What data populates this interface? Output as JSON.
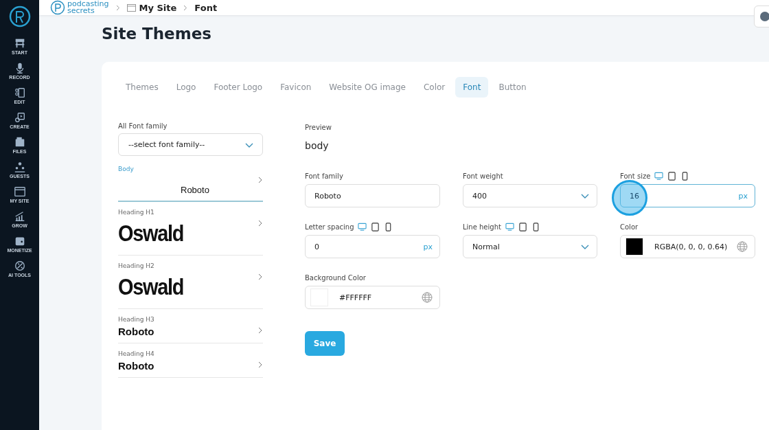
{
  "sidebar": {
    "items": [
      {
        "label": "START"
      },
      {
        "label": "RECORD"
      },
      {
        "label": "EDIT"
      },
      {
        "label": "CREATE"
      },
      {
        "label": "FILES"
      },
      {
        "label": "GUESTS"
      },
      {
        "label": "MY SITE"
      },
      {
        "label": "GROW"
      },
      {
        "label": "MONETIZE"
      },
      {
        "label": "AI TOOLS"
      }
    ]
  },
  "header": {
    "logo_line1": "podcasting",
    "logo_line2": "secrets",
    "breadcrumbs": [
      "My Site",
      "Font"
    ]
  },
  "page_title": "Site Themes",
  "tabs": [
    {
      "label": "Themes",
      "selected": false
    },
    {
      "label": "Logo",
      "selected": false
    },
    {
      "label": "Footer Logo",
      "selected": false
    },
    {
      "label": "Favicon",
      "selected": false
    },
    {
      "label": "Website OG image",
      "selected": false
    },
    {
      "label": "Color",
      "selected": false
    },
    {
      "label": "Font",
      "selected": true
    },
    {
      "label": "Button",
      "selected": false
    }
  ],
  "font_list": {
    "label": "All Font family",
    "select_value": "--select font family--",
    "items": [
      {
        "label": "Body",
        "font": "Roboto",
        "kind": "body",
        "selected": true
      },
      {
        "label": "Heading H1",
        "font": "Oswald",
        "kind": "display",
        "selected": false
      },
      {
        "label": "Heading H2",
        "font": "Oswald",
        "kind": "display",
        "selected": false
      },
      {
        "label": "Heading H3",
        "font": "Roboto",
        "kind": "heading",
        "selected": false
      },
      {
        "label": "Heading H4",
        "font": "Roboto",
        "kind": "heading",
        "selected": false
      }
    ]
  },
  "preview": {
    "label": "Preview",
    "text": "body"
  },
  "fields": [
    {
      "label": "Font family",
      "kind": "text",
      "value": "Roboto"
    },
    {
      "label": "Font weight",
      "kind": "select",
      "value": "400"
    },
    {
      "label": "Font size",
      "kind": "number",
      "value": "16",
      "unit": "px",
      "focused": true,
      "devices": [
        {
          "selected": true
        },
        {
          "selected": false
        },
        {
          "selected": false
        }
      ]
    },
    {
      "label": "Letter spacing",
      "kind": "number",
      "value": "0",
      "unit": "px",
      "focused": false,
      "devices": [
        {
          "selected": true
        },
        {
          "selected": false
        },
        {
          "selected": false
        }
      ]
    },
    {
      "label": "Line height",
      "kind": "select",
      "value": "Normal",
      "devices": [
        {
          "selected": true
        },
        {
          "selected": false
        },
        {
          "selected": false
        }
      ]
    },
    {
      "label": "Color",
      "kind": "color",
      "value": "RGBA(0, 0, 0, 0.64)",
      "color": "#000000"
    },
    {
      "label": "Background Color",
      "kind": "color",
      "value": "#FFFFFF",
      "color": "#ffffff"
    }
  ],
  "save_button": "Save"
}
